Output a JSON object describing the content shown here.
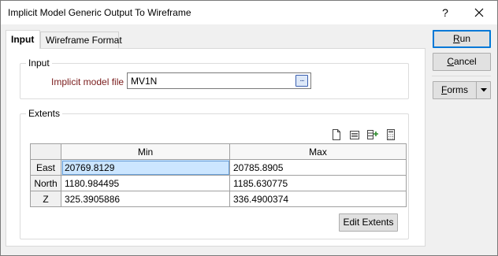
{
  "window": {
    "title": "Implicit Model Generic Output To Wireframe",
    "help_glyph": "?"
  },
  "tabs": [
    {
      "label": "Input",
      "active": true
    },
    {
      "label": "Wireframe Format",
      "active": false
    }
  ],
  "input_group": {
    "label": "Input",
    "implicit_model_file_label": "Implicit model file",
    "implicit_model_file_value": "MV1N",
    "browse_glyph": "..."
  },
  "extents_group": {
    "label": "Extents",
    "toolbar_icons": [
      "new-document-icon",
      "list-icon",
      "insert-row-icon",
      "calculator-icon"
    ],
    "columns": [
      "Min",
      "Max"
    ],
    "rows": [
      {
        "name": "East",
        "min": "20769.8129",
        "max": "20785.8905",
        "selected": "min"
      },
      {
        "name": "North",
        "min": "1180.984495",
        "max": "1185.630775"
      },
      {
        "name": "Z",
        "min": "325.3905886",
        "max": "336.4900374"
      }
    ],
    "edit_extents_label": "Edit Extents"
  },
  "side_buttons": {
    "run": {
      "mnemonic": "R",
      "rest": "un"
    },
    "cancel": {
      "mnemonic": "C",
      "rest": "ancel"
    },
    "forms": {
      "mnemonic": "F",
      "rest": "orms"
    }
  },
  "colors": {
    "required_label": "#7a1c1c",
    "selection": "#cce6ff",
    "default_button_border": "#0078d7"
  }
}
